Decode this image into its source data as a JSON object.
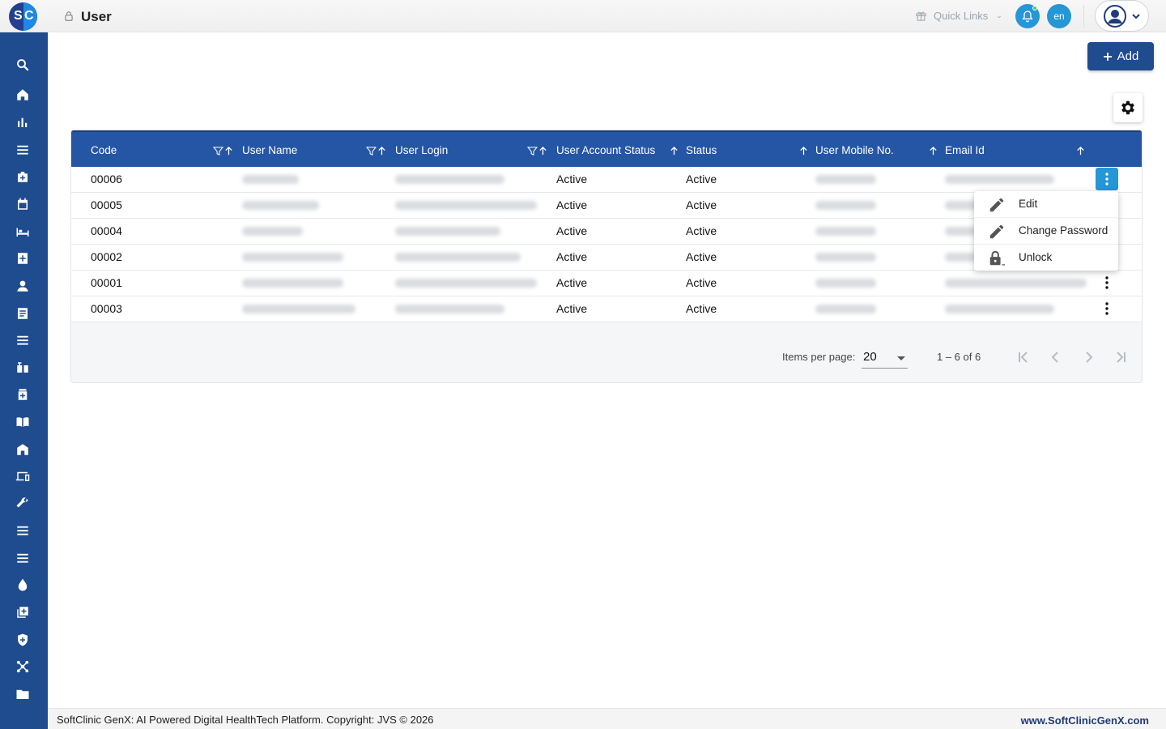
{
  "header": {
    "logo_left": "S",
    "logo_right": "C",
    "page_title": "User",
    "quick_links_label": "Quick Links",
    "language": "en"
  },
  "sidebar": {
    "icons": [
      "search-icon",
      "home-icon",
      "bar-chart-icon",
      "menu-icon",
      "medical-bag-icon",
      "calendar-icon",
      "bed-icon",
      "medical-plus-icon",
      "person-icon",
      "document-icon",
      "menu-icon",
      "vaccine-icon",
      "medicine-icon",
      "book-icon",
      "building-icon",
      "devices-icon",
      "wrench-icon",
      "menu-icon",
      "menu-icon",
      "drop-icon",
      "add-box-icon",
      "shield-icon",
      "hub-icon",
      "folder-icon"
    ]
  },
  "toolbar": {
    "add_label": "Add"
  },
  "table": {
    "columns": [
      "Code",
      "User Name",
      "User Login",
      "User Account Status",
      "Status",
      "User Mobile No.",
      "Email Id"
    ],
    "rows": [
      {
        "code": "00006",
        "account_status": "Active",
        "status": "Active"
      },
      {
        "code": "00005",
        "account_status": "Active",
        "status": "Active"
      },
      {
        "code": "00004",
        "account_status": "Active",
        "status": "Active"
      },
      {
        "code": "00002",
        "account_status": "Active",
        "status": "Active"
      },
      {
        "code": "00001",
        "account_status": "Active",
        "status": "Active"
      },
      {
        "code": "00003",
        "account_status": "Active",
        "status": "Active"
      }
    ]
  },
  "context_menu": {
    "items": [
      {
        "label": "Edit",
        "icon": "pencil-icon"
      },
      {
        "label": "Change Password",
        "icon": "pencil-icon"
      },
      {
        "label": "Unlock",
        "icon": "lock-icon"
      }
    ]
  },
  "pagination": {
    "items_per_page_label": "Items per page:",
    "items_per_page": "20",
    "range": "1 – 6 of 6"
  },
  "footer": {
    "copyright": "SoftClinic GenX: AI Powered Digital HealthTech Platform. Copyright: JVS © 2026",
    "website": "www.SoftClinicGenX.com"
  },
  "colors": {
    "brand": "#1f4b8f",
    "table_header": "#2456a5",
    "accent": "#2596d6"
  }
}
